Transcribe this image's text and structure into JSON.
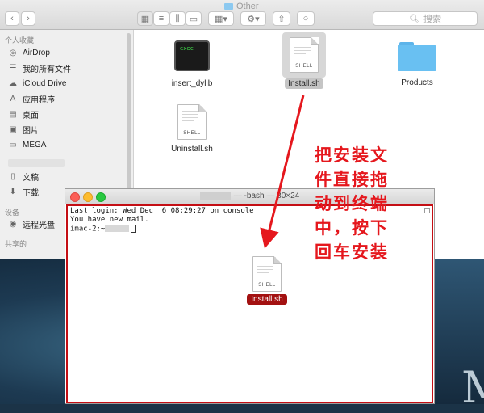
{
  "finder": {
    "title": "Other",
    "search_placeholder": "搜索",
    "toolbar": {
      "back_icon": "chevron-left-icon",
      "forward_icon": "chevron-right-icon"
    },
    "sidebar": {
      "favorites_header": "个人收藏",
      "items": [
        {
          "label": "AirDrop",
          "icon": "airdrop-icon"
        },
        {
          "label": "我的所有文件",
          "icon": "all-files-icon"
        },
        {
          "label": "iCloud Drive",
          "icon": "cloud-icon"
        },
        {
          "label": "应用程序",
          "icon": "applications-icon"
        },
        {
          "label": "桌面",
          "icon": "desktop-icon"
        },
        {
          "label": "图片",
          "icon": "camera-icon"
        },
        {
          "label": "MEGA",
          "icon": "folder-icon"
        },
        {
          "label": "文稿",
          "icon": "document-icon"
        },
        {
          "label": "下载",
          "icon": "download-icon"
        }
      ],
      "devices_header": "设备",
      "devices": [
        {
          "label": "远程光盘",
          "icon": "disc-icon"
        }
      ],
      "shared_header": "共享的"
    },
    "files": [
      {
        "name": "insert_dylib",
        "type": "exec",
        "badge": "exec"
      },
      {
        "name": "Install.sh",
        "type": "shell",
        "badge": "SHELL",
        "selected": true
      },
      {
        "name": "Products",
        "type": "folder"
      },
      {
        "name": "Uninstall.sh",
        "type": "shell",
        "badge": "SHELL"
      }
    ]
  },
  "terminal": {
    "title_suffix": "— -bash — 80×24",
    "lines": [
      "Last login: Wed Dec  6 08:29:27 on console",
      "You have new mail."
    ],
    "prompt_prefix": "imac-2:~",
    "dragged_file": {
      "name": "Install.sh",
      "badge": "SHELL"
    }
  },
  "annotation": {
    "text": "把安装文件直接拖动到终端中，按下回车安装",
    "lines": [
      "把安装文",
      "件直接拖",
      "动到终端",
      "中，按下",
      "回车安装"
    ],
    "color": "#e5171d"
  },
  "desktop": {
    "glyph": "M"
  }
}
